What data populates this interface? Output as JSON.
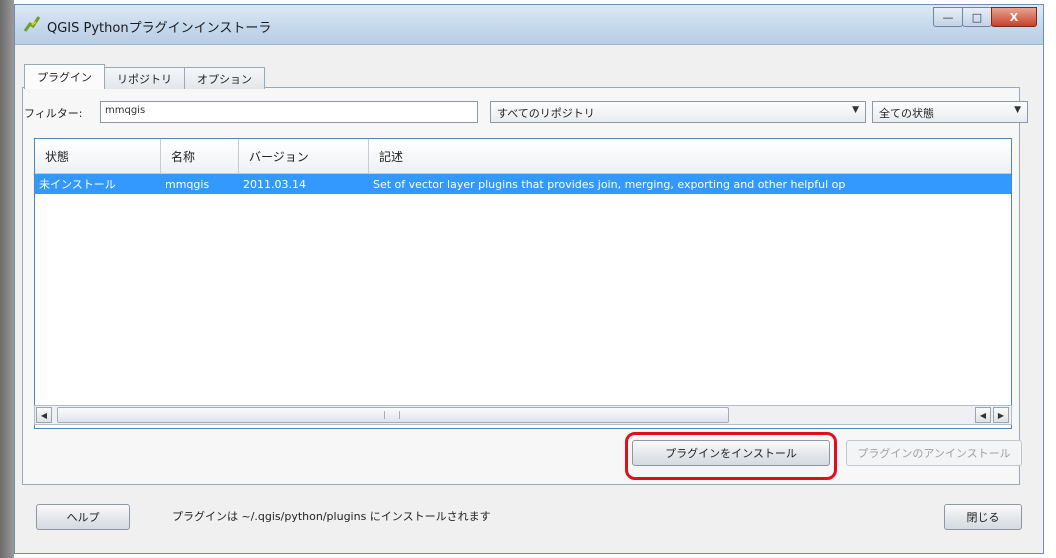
{
  "window": {
    "title": "QGIS Pythonプラグインインストーラ",
    "minimize_glyph": "—",
    "maximize_glyph": "□",
    "close_glyph": "X"
  },
  "tabs": [
    {
      "label": "プラグイン"
    },
    {
      "label": "リポジトリ"
    },
    {
      "label": "オプション"
    }
  ],
  "filter": {
    "label": "フィルター:",
    "value": "mmqgis"
  },
  "repository_combo": {
    "value": "すべてのリポジトリ",
    "arrow": "▼"
  },
  "state_combo": {
    "value": "全ての状態",
    "arrow": "▼"
  },
  "table": {
    "columns": [
      "状態",
      "名称",
      "バージョン",
      "記述"
    ],
    "rows": [
      {
        "status": "未インストール",
        "name": "mmqgis",
        "version": "2011.03.14",
        "description": "Set of vector layer plugins that provides join, merging, exporting and other helpful op"
      }
    ]
  },
  "scrollbar": {
    "left_glyph": "◀",
    "right_glyph": "▶"
  },
  "buttons": {
    "install": "プラグインをインストール",
    "uninstall": "プラグインのアンインストール",
    "help": "ヘルプ",
    "close": "閉じる"
  },
  "status": {
    "text": "プラグインは ~/.qgis/python/plugins にインストールされます"
  },
  "colors": {
    "selection": "#3399ff",
    "highlight_box": "#e0101a",
    "accent": "#4d86c4"
  },
  "icons": {
    "app": "qgis-logo-icon"
  }
}
